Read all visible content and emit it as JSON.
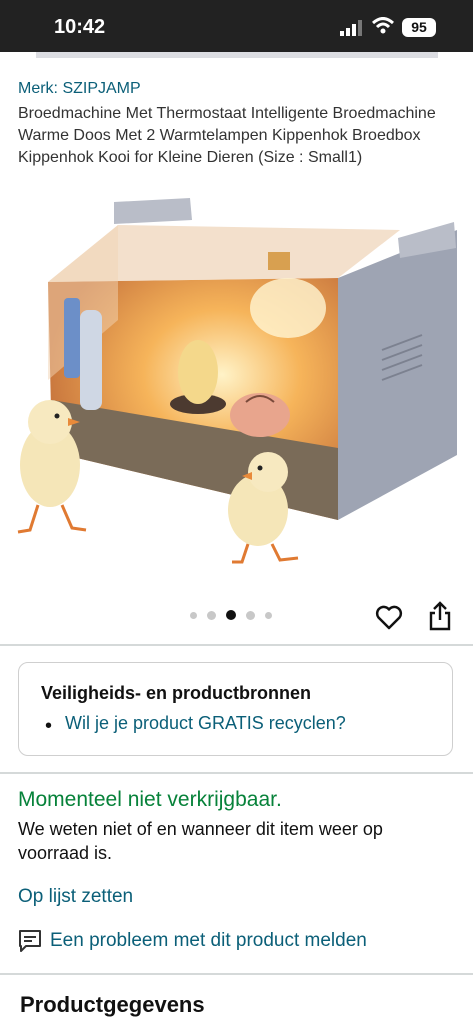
{
  "status_bar": {
    "time": "10:42",
    "battery": "95"
  },
  "product": {
    "brand_link": "Merk: SZIPJAMP",
    "title": "Broedmachine Met Thermostaat Intelligente Broedmachine Warme Doos Met 2 Warmtelampen Kippenhok Broedbox Kippenhok Kooi for Kleine Dieren (Size : Small1)"
  },
  "gallery": {
    "total_images": 5,
    "active_index": 2
  },
  "safety": {
    "title": "Veiligheids- en productbronnen",
    "link": "Wil je je product GRATIS recyclen?"
  },
  "availability": {
    "status": "Momenteel niet verkrijgbaar.",
    "text": "We weten niet of en wanneer dit item weer op voorraad is."
  },
  "actions": {
    "add_to_list": "Op lijst zetten",
    "report": "Een probleem met dit product melden"
  },
  "details": {
    "title": "Productgegevens"
  },
  "colors": {
    "link": "#0b5f78",
    "available_green": "#07823a"
  }
}
